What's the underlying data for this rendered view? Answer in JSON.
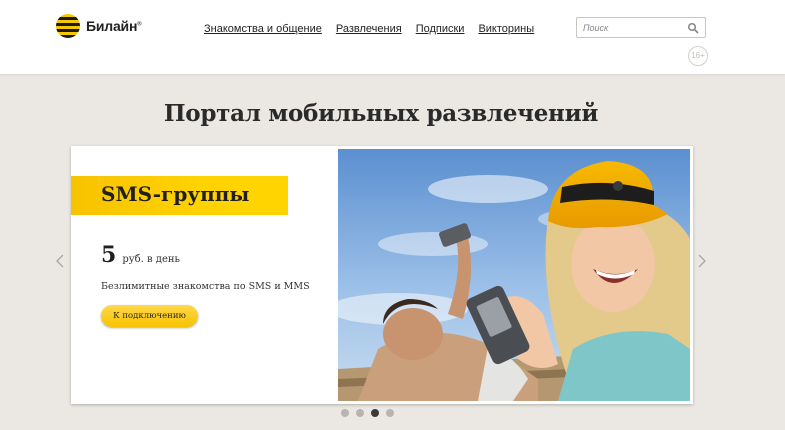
{
  "header": {
    "logo_text": "Билайн",
    "nav": [
      {
        "label": "Знакомства и общение"
      },
      {
        "label": "Развлечения"
      },
      {
        "label": "Подписки"
      },
      {
        "label": "Викторины"
      }
    ],
    "search": {
      "placeholder": "Поиск"
    },
    "age_badge": "16+"
  },
  "page_title": "Портал мобильных развлечений",
  "slide": {
    "promo_title": "SMS-группы",
    "price_value": "5",
    "price_unit": "руб. в день",
    "description": "Безлимитные знакомства по SMS и MMS",
    "button_label": "К подключению"
  },
  "pager": {
    "count": 4,
    "active_index": 2
  },
  "colors": {
    "brand_yellow": "#ffd200",
    "background": "#ebe8e3",
    "text": "#1f1f1f"
  }
}
